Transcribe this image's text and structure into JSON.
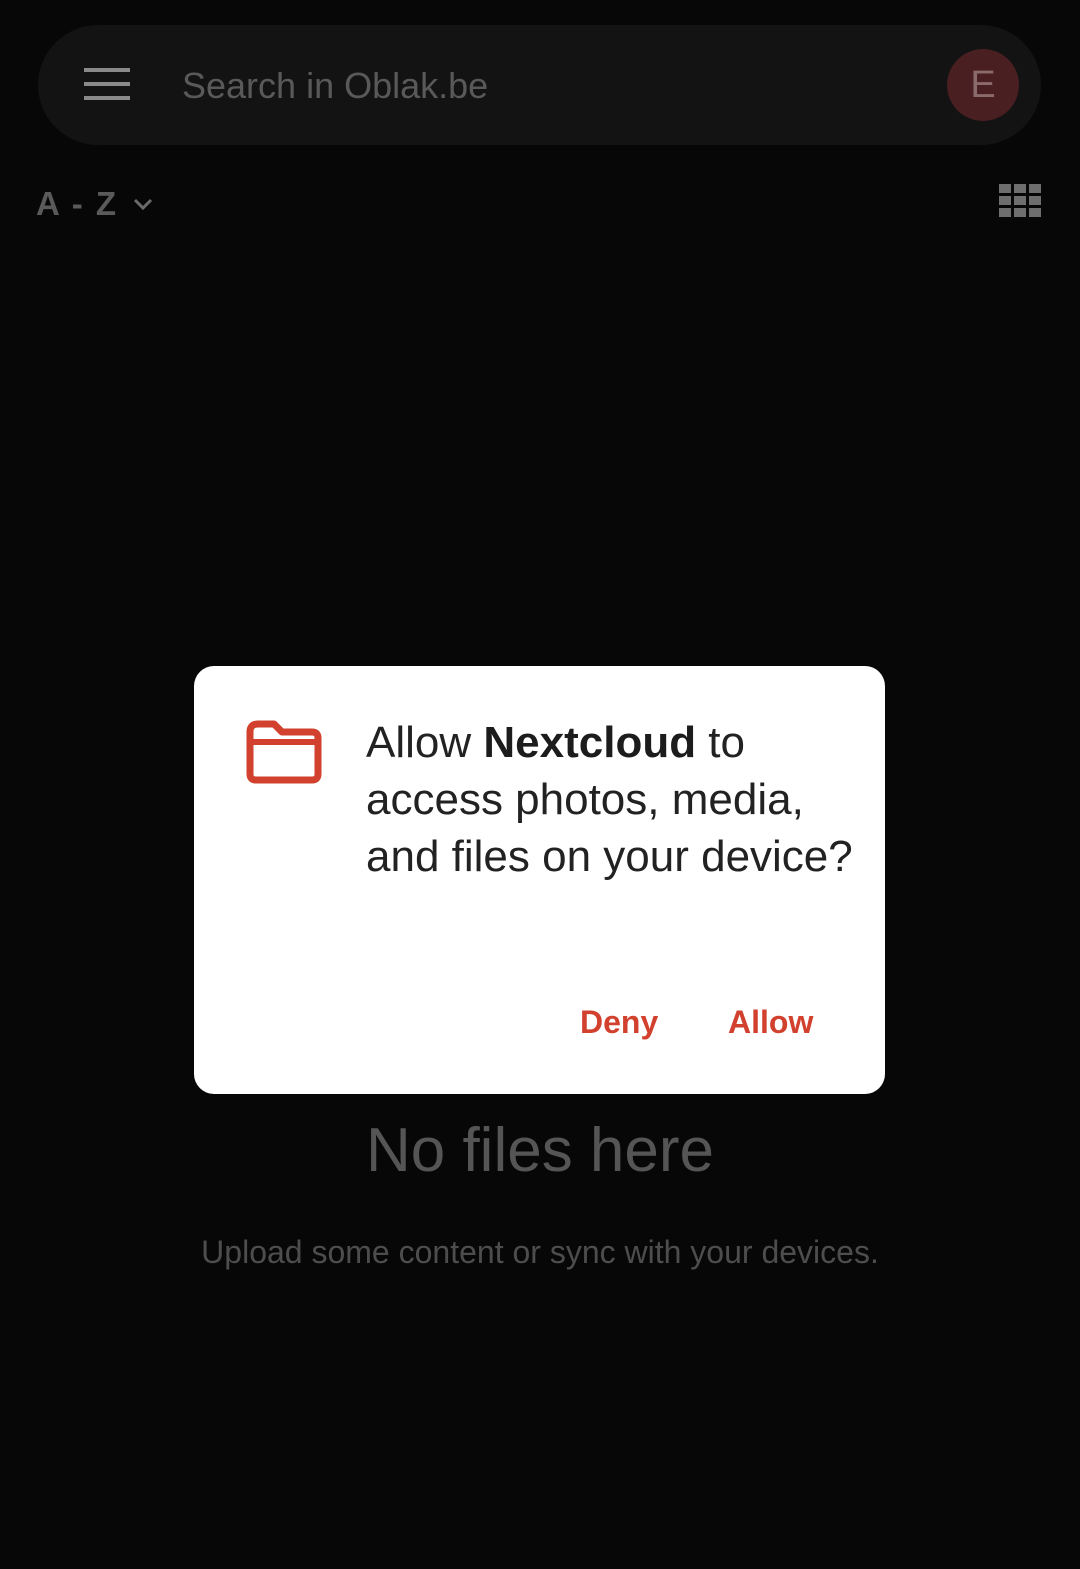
{
  "search": {
    "placeholder": "Search in Oblak.be",
    "value": ""
  },
  "account": {
    "avatar_letter": "E",
    "avatar_color": "#4a1f22"
  },
  "toolbar": {
    "sort_label": "A - Z",
    "sort_icon": "chevron-down-icon",
    "view_icon": "grid-view-icon"
  },
  "empty_state": {
    "title": "No files here",
    "subtitle": "Upload some content or sync with your devices."
  },
  "dialog": {
    "icon": "folder-icon",
    "message_prefix": "Allow ",
    "app_name": "Nextcloud",
    "message_suffix": " to access photos, media, and files on your device?",
    "deny_label": "Deny",
    "allow_label": "Allow",
    "accent_color": "#d2402e"
  }
}
